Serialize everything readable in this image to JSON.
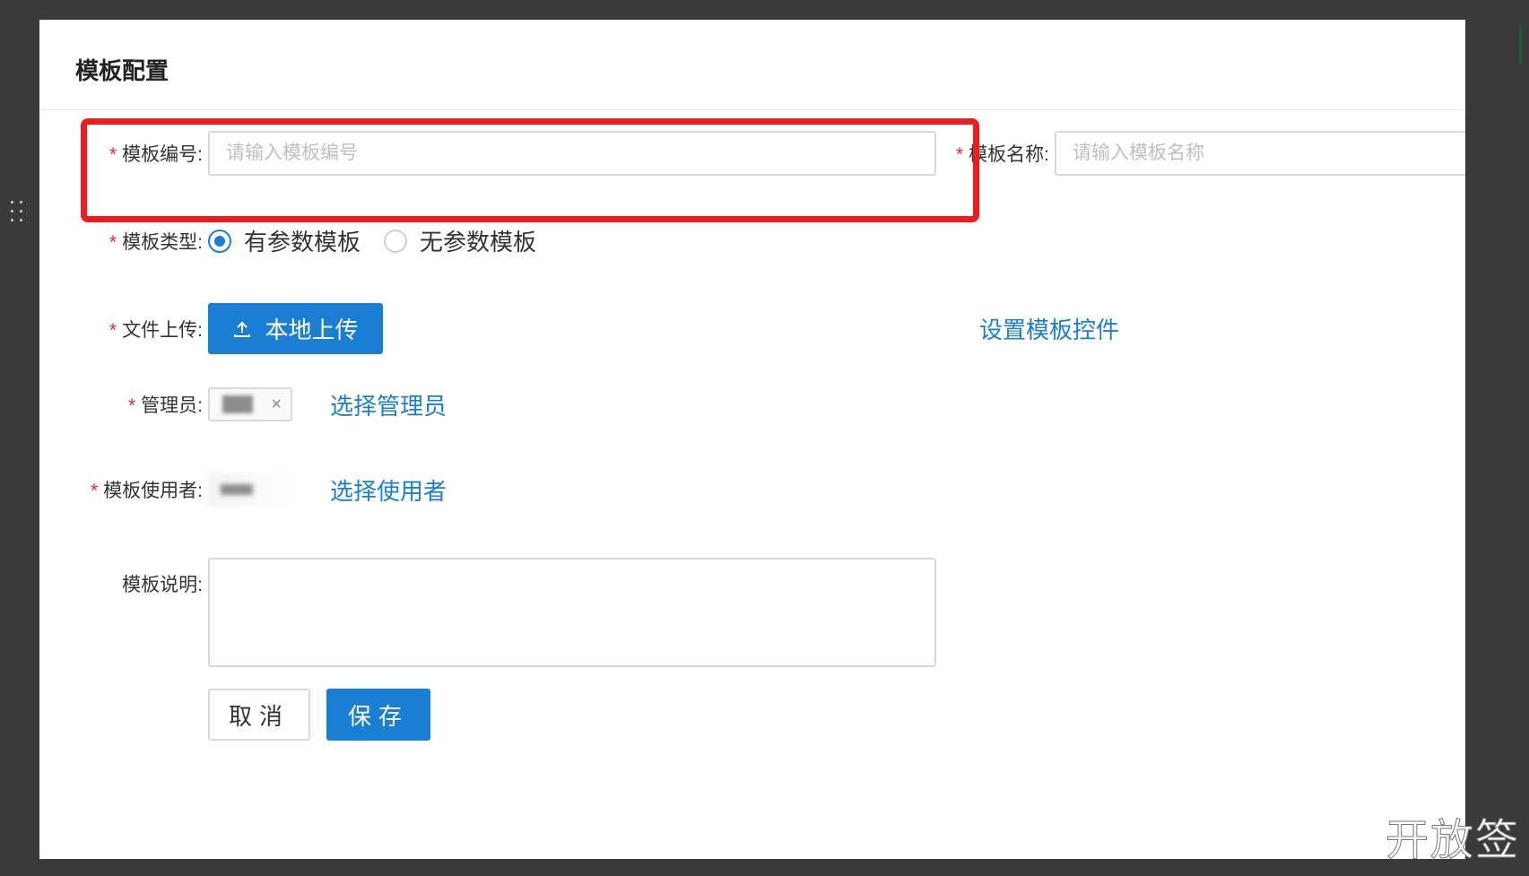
{
  "dialog": {
    "title": "模板配置"
  },
  "form": {
    "template_no": {
      "label": "模板编号:",
      "placeholder": "请输入模板编号",
      "value": ""
    },
    "template_name": {
      "label": "模板名称:",
      "placeholder": "请输入模板名称",
      "value": ""
    },
    "template_type": {
      "label": "模板类型:",
      "options": [
        {
          "label": "有参数模板",
          "checked": true
        },
        {
          "label": "无参数模板",
          "checked": false
        }
      ]
    },
    "file_upload": {
      "label": "文件上传:",
      "button": "本地上传",
      "icon": "upload-icon",
      "configure_link": "设置模板控件"
    },
    "admin": {
      "label": "管理员:",
      "tag_close": "×",
      "select_link": "选择管理员"
    },
    "users": {
      "label": "模板使用者:",
      "select_link": "选择使用者"
    },
    "description": {
      "label": "模板说明:",
      "value": ""
    },
    "required_mark": "*"
  },
  "actions": {
    "cancel": "取消",
    "save": "保存"
  },
  "watermark": "开放签",
  "colors": {
    "primary": "#1a7fd4",
    "required": "#f5222d",
    "highlight": "#ee1c1c",
    "backdrop": "#3a3a3a"
  }
}
